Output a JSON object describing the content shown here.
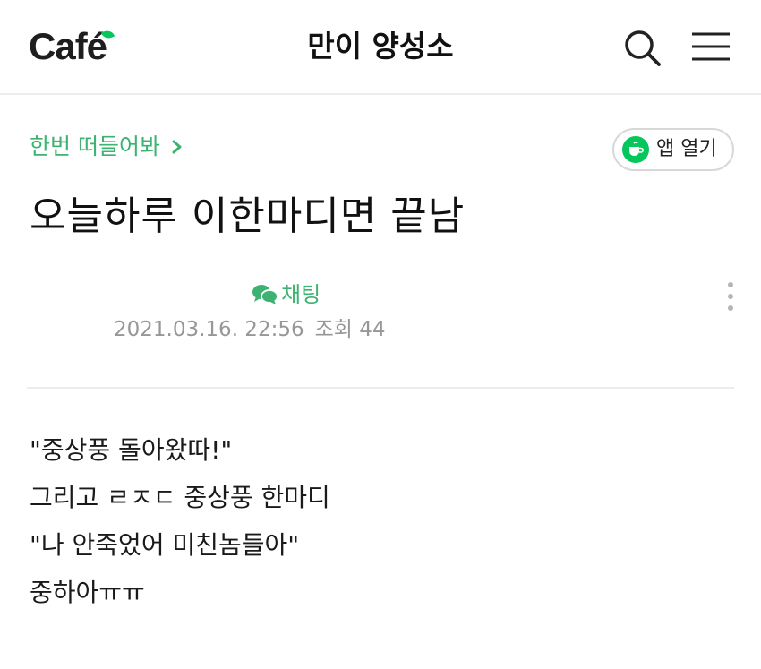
{
  "header": {
    "logo_text": "Café",
    "cafe_name": "만이 양성소",
    "search_icon": "search-icon",
    "menu_icon": "hamburger-menu-icon",
    "accent_color": "#03c75a"
  },
  "article": {
    "board_name": "한번 떠들어봐",
    "open_app_label": "앱 열기",
    "title": "오늘하루 이한마디면 끝남",
    "chat_label": "채팅",
    "date": "2021.03.16. 22:56",
    "views_label": "조회 44",
    "body_lines": [
      "\"중상풍 돌아왔따!\"",
      "그리고 ㄹㅈㄷ 중상풍 한마디",
      "\"나 안죽었어 미친놈들아\"",
      "중하아ㅠㅠ"
    ],
    "link_color": "#3cb371"
  }
}
